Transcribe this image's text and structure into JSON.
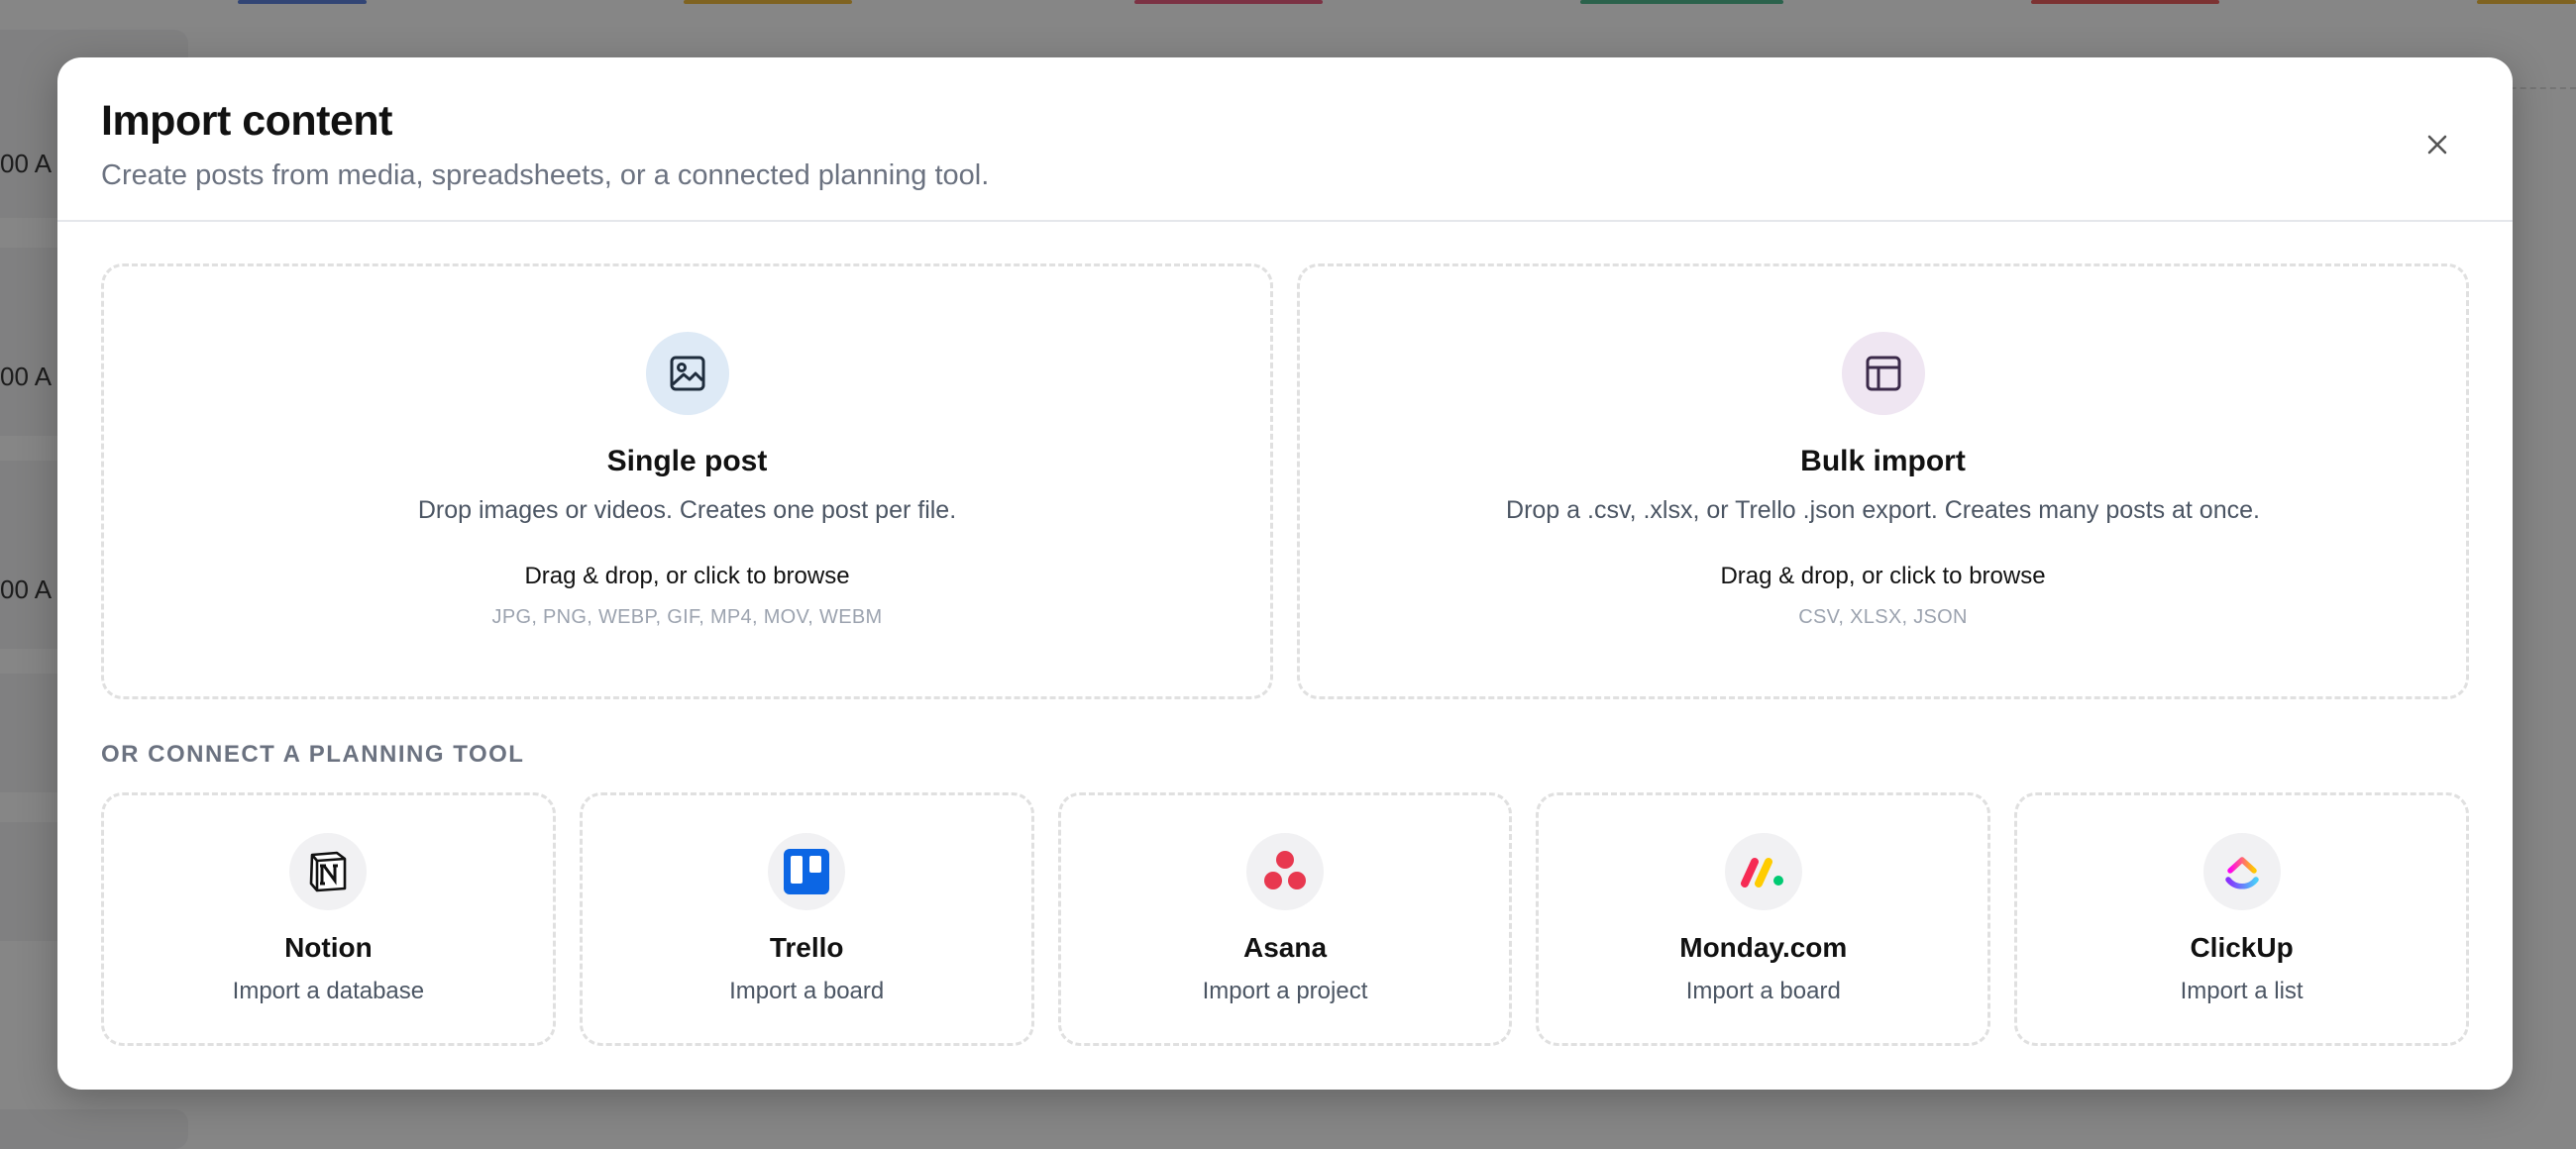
{
  "background": {
    "times": [
      "00 A",
      "00 A",
      "00 A"
    ]
  },
  "modal": {
    "title": "Import content",
    "subtitle": "Create posts from media, spreadsheets, or a connected planning tool.",
    "close_icon": "close-icon"
  },
  "drop_zones": [
    {
      "title": "Single post",
      "description": "Drop images or videos. Creates one post per file.",
      "action": "Drag & drop, or click to browse",
      "formats": "JPG, PNG, WEBP, GIF, MP4, MOV, WEBM",
      "icon": "image-icon"
    },
    {
      "title": "Bulk import",
      "description": "Drop a .csv, .xlsx, or Trello .json export. Creates many posts at once.",
      "action": "Drag & drop, or click to browse",
      "formats": "CSV, XLSX, JSON",
      "icon": "layout-icon"
    }
  ],
  "tools_section_label": "OR CONNECT A PLANNING TOOL",
  "tools": [
    {
      "name": "Notion",
      "description": "Import a database",
      "icon": "notion-icon"
    },
    {
      "name": "Trello",
      "description": "Import a board",
      "icon": "trello-icon"
    },
    {
      "name": "Asana",
      "description": "Import a project",
      "icon": "asana-icon"
    },
    {
      "name": "Monday.com",
      "description": "Import a board",
      "icon": "monday-icon"
    },
    {
      "name": "ClickUp",
      "description": "Import a list",
      "icon": "clickup-icon"
    }
  ],
  "colors": {
    "image_icon_bg": "#deeaf6",
    "layout_icon_bg": "#efe6f2",
    "trello_blue": "#0c66e4",
    "asana_red": "#e8384f",
    "overlay": "rgba(0,0,0,0.45)"
  }
}
